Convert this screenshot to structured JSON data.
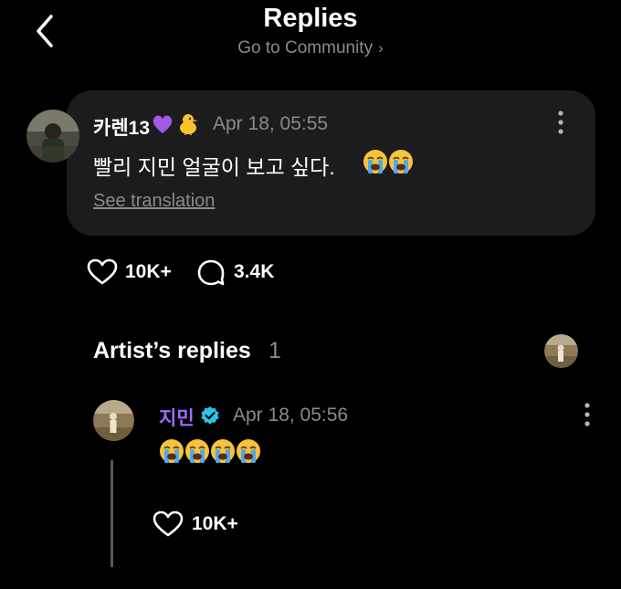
{
  "header": {
    "title": "Replies",
    "community_link": "Go to Community",
    "chevron": "›"
  },
  "post": {
    "author": "카렌13",
    "author_emojis": [
      "purple-heart-emoji",
      "chick-emoji"
    ],
    "time": "Apr 18, 05:55",
    "text": "빨리 지민 얼굴이 보고 싶다.",
    "text_emojis": [
      "loudly-crying-face",
      "loudly-crying-face"
    ],
    "translate_label": "See translation",
    "likes": "10K+",
    "comments": "3.4K"
  },
  "artist_replies": {
    "title": "Artist’s replies",
    "count": "1",
    "replies": [
      {
        "author": "지민",
        "verified": true,
        "time": "Apr 18, 05:56",
        "emojis": [
          "loudly-crying-face",
          "loudly-crying-face",
          "loudly-crying-face",
          "loudly-crying-face"
        ],
        "likes": "10K+"
      }
    ]
  },
  "colors": {
    "background": "#000000",
    "card": "#1c1c1e",
    "muted_text": "#8a8a8a",
    "artist_name": "#a06bff",
    "verified_badge": "#2bc4e6"
  }
}
